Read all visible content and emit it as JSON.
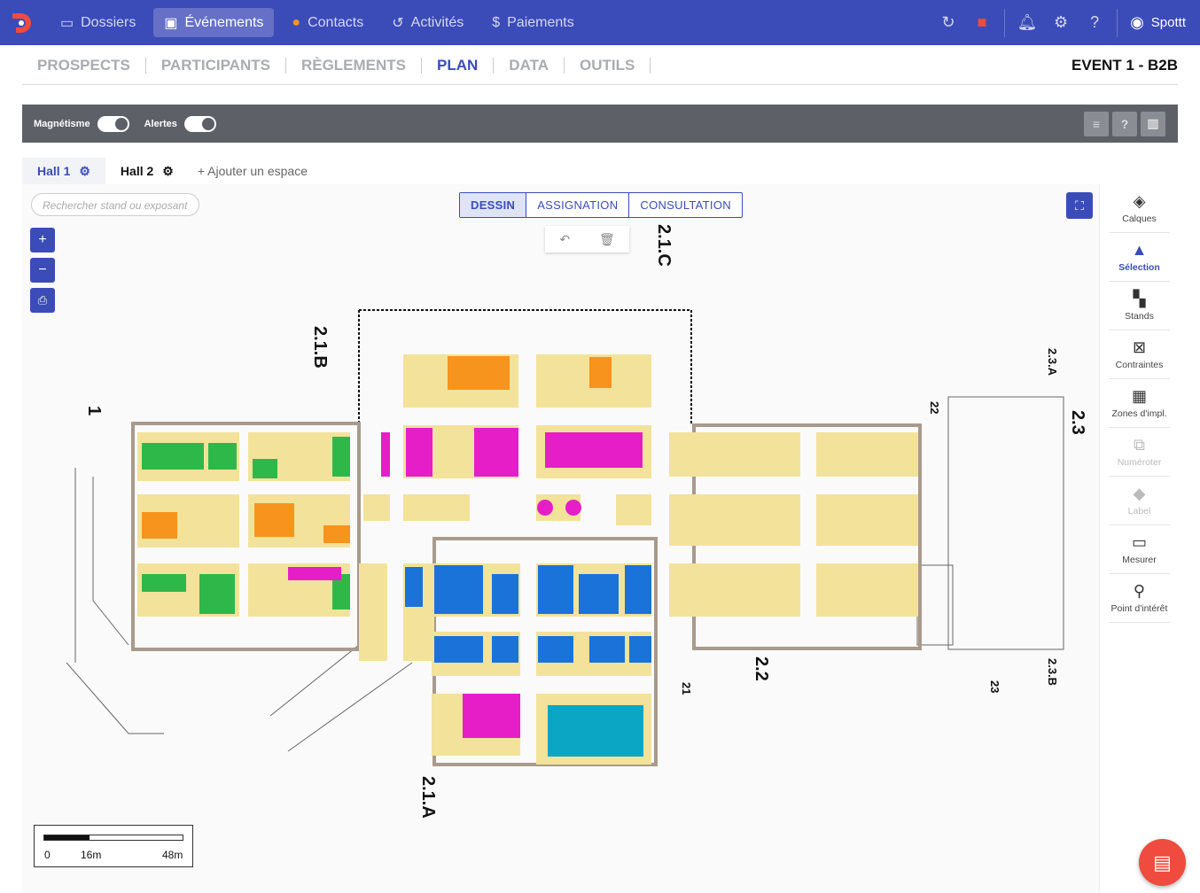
{
  "topbar": {
    "nav": [
      {
        "label": "Dossiers",
        "icon": "folder-icon"
      },
      {
        "label": "Événements",
        "icon": "calendar-icon",
        "active": true
      },
      {
        "label": "Contacts",
        "icon": "contacts-icon"
      },
      {
        "label": "Activités",
        "icon": "history-icon"
      },
      {
        "label": "Paiements",
        "icon": "dollar-icon"
      }
    ],
    "user": "Spottt"
  },
  "subnav": {
    "items": [
      "PROSPECTS",
      "PARTICIPANTS",
      "RÈGLEMENTS",
      "PLAN",
      "DATA",
      "OUTILS"
    ],
    "active": "PLAN",
    "event": "EVENT 1 - B2B"
  },
  "toolbar": {
    "magnetism": "Magnétisme",
    "alerts": "Alertes",
    "magnetism_on": true,
    "alerts_on": true
  },
  "halls": {
    "tabs": [
      "Hall 1",
      "Hall 2"
    ],
    "active": "Hall 1",
    "add": "+ Ajouter un espace"
  },
  "canvas": {
    "search_placeholder": "Rechercher stand ou exposant",
    "modes": [
      "DESSIN",
      "ASSIGNATION",
      "CONSULTATION"
    ],
    "active_mode": "DESSIN",
    "hall_labels": [
      "2.1.B",
      "2.1.C",
      "2.1.A",
      "2.2",
      "2.3",
      "2.3.A",
      "2.3.B",
      "1",
      "21",
      "22",
      "23"
    ],
    "scale": {
      "start": "0",
      "mid": "16m",
      "end": "48m"
    }
  },
  "sidebar": [
    {
      "label": "Calques",
      "state": "normal"
    },
    {
      "label": "Sélection",
      "state": "active"
    },
    {
      "label": "Stands",
      "state": "normal"
    },
    {
      "label": "Contraintes",
      "state": "normal"
    },
    {
      "label": "Zones d'impl.",
      "state": "normal"
    },
    {
      "label": "Numéroter",
      "state": "disabled"
    },
    {
      "label": "Label",
      "state": "disabled"
    },
    {
      "label": "Mesurer",
      "state": "normal"
    },
    {
      "label": "Point d'intérêt",
      "state": "normal"
    }
  ],
  "colors": {
    "brand": "#3b4cb8",
    "stand_yellow": "#f3e29a",
    "stand_green": "#2fb84a",
    "stand_orange": "#f7941d",
    "stand_magenta": "#e61ec8",
    "stand_blue": "#1a73d9",
    "stand_teal": "#0aa6c4",
    "chat": "#ef4b3f"
  }
}
